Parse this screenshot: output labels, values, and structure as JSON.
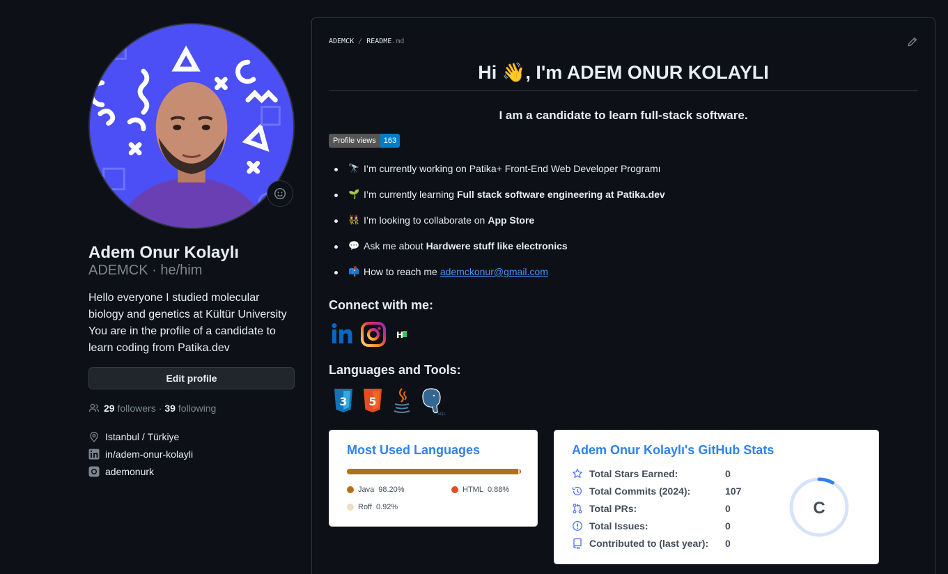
{
  "profile": {
    "full_name": "Adem Onur Kolaylı",
    "subline": "ADEMCK · he/him",
    "bio": "Hello everyone I studied molecular biology and genetics at Kültür University You are in the profile of a candidate to learn coding from Patika.dev",
    "edit_button": "Edit profile",
    "followers_count": "29",
    "followers_label": "followers",
    "dot_sep": "·",
    "following_count": "39",
    "following_label": "following",
    "location": "Istanbul / Türkiye",
    "linkedin": "in/adem-onur-kolayli",
    "instagram": "ademonurk"
  },
  "readme": {
    "crumb_user": "ADEMCK",
    "crumb_sep": "/",
    "crumb_file": "README",
    "crumb_ext": ".md",
    "heading": "Hi 👋, I'm ADEM ONUR KOLAYLI",
    "tagline": "I am a candidate to learn full-stack software.",
    "badge_label": "Profile views",
    "badge_value": "163",
    "items": [
      {
        "emoji": "🔭",
        "text": "I’m currently working on Patika+ Front-End Web Developer Programı",
        "bold": ""
      },
      {
        "emoji": "🌱",
        "text": "I’m currently learning",
        "bold": "Full stack software engineering at Patika.dev"
      },
      {
        "emoji": "👯",
        "text": "I’m looking to collaborate on",
        "bold": "App Store"
      },
      {
        "emoji": "💬",
        "text": "Ask me about",
        "bold": "Hardwere stuff like electronics"
      },
      {
        "emoji": "📫",
        "text": "How to reach me",
        "link": "ademckonur@gmail.com"
      }
    ],
    "connect_heading": "Connect with me:",
    "tools_heading": "Languages and Tools:"
  },
  "languages_card": {
    "title": "Most Used Languages",
    "langs": [
      {
        "name": "Java",
        "percent": "98.20%",
        "value": 98.2,
        "color": "#b07219"
      },
      {
        "name": "HTML",
        "percent": "0.88%",
        "value": 0.88,
        "color": "#e34c26"
      },
      {
        "name": "Roff",
        "percent": "0.92%",
        "value": 0.92,
        "color": "#ecdebe"
      }
    ]
  },
  "stats_card": {
    "title": "Adem Onur Kolaylı's GitHub Stats",
    "rows": [
      {
        "icon": "star-icon",
        "label": "Total Stars Earned:",
        "value": "0"
      },
      {
        "icon": "history-icon",
        "label": "Total Commits (2024):",
        "value": "107"
      },
      {
        "icon": "pull-request-icon",
        "label": "Total PRs:",
        "value": "0"
      },
      {
        "icon": "issue-icon",
        "label": "Total Issues:",
        "value": "0"
      },
      {
        "icon": "repo-icon",
        "label": "Contributed to (last year):",
        "value": "0"
      }
    ],
    "rank": "C",
    "rank_progress": 0.08
  },
  "colors": {
    "background": "#0d1117",
    "link": "#4493f8",
    "card_title": "#2f80ed"
  }
}
